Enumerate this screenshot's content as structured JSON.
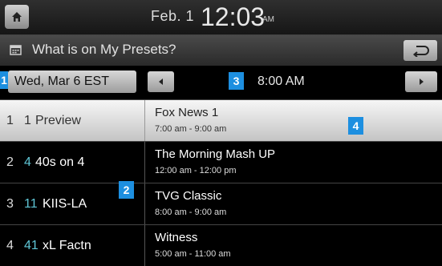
{
  "status": {
    "date": "Feb.  1",
    "time": "12:03",
    "ampm": "AM"
  },
  "header": {
    "title": "What is on My Presets?"
  },
  "nav": {
    "date_label": "Wed, Mar 6 EST",
    "time_label": "8:00 AM"
  },
  "badges": {
    "b1": "1",
    "b2": "2",
    "b3": "3",
    "b4": "4"
  },
  "rows": [
    {
      "index": "1",
      "channel_number": "1",
      "channel_name": "Preview",
      "program": "Fox News 1",
      "program_time": "7:00 am - 9:00 am",
      "selected": true
    },
    {
      "index": "2",
      "channel_number": "4",
      "channel_name": "40s on 4",
      "program": "The Morning Mash UP",
      "program_time": "12:00 am - 12:00 pm",
      "selected": false
    },
    {
      "index": "3",
      "channel_number": "11",
      "channel_name": "KIIS-LA",
      "program": "TVG Classic",
      "program_time": "8:00 am - 9:00 am",
      "selected": false
    },
    {
      "index": "4",
      "channel_number": "41",
      "channel_name": "xL Factn",
      "program": "Witness",
      "program_time": "5:00 am - 11:00 am",
      "selected": false
    }
  ],
  "icons": {
    "home": "home-icon",
    "calendar": "calendar-icon",
    "back": "back-arrow-icon",
    "prev": "left-arrow-icon",
    "next": "right-arrow-icon"
  },
  "colors": {
    "accent": "#1d8fe0",
    "channel_number": "#5fc6d6"
  }
}
